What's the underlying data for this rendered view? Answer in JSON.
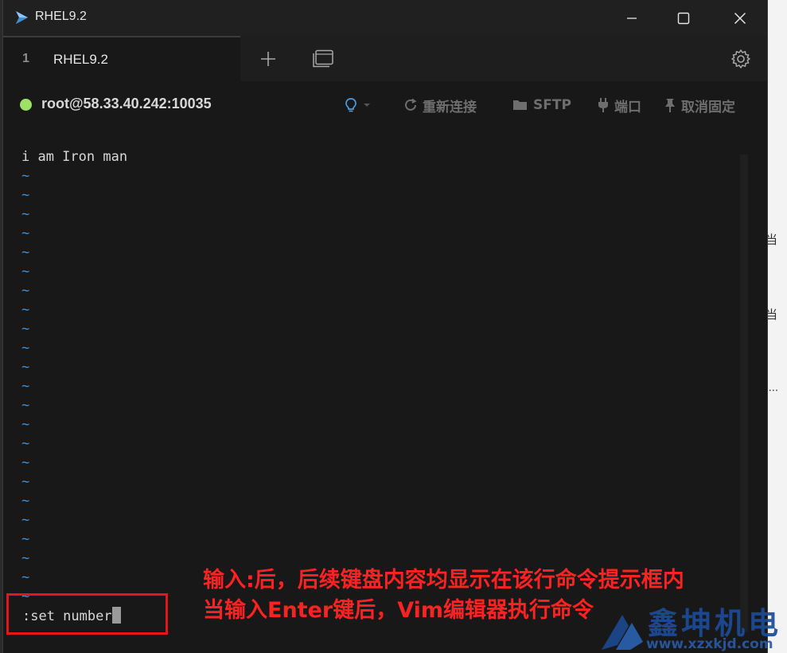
{
  "window": {
    "title": "RHEL9.2",
    "controls": {
      "minimize": "minimize-icon",
      "maximize": "maximize-icon",
      "close": "close-icon"
    }
  },
  "tabs": [
    {
      "index": "1",
      "label": "RHEL9.2"
    }
  ],
  "tabbar_icons": [
    "plus-icon",
    "windows-icon",
    "gear-icon"
  ],
  "status": {
    "connected_color": "#9ee265",
    "host": "root@58.33.40.242:10035",
    "items": [
      {
        "label": "重新连接",
        "icon": "refresh-icon"
      },
      {
        "label": "SFTP",
        "icon": "folder-icon"
      },
      {
        "label": "端口",
        "icon": "plug-icon"
      },
      {
        "label": "取消固定",
        "icon": "pin-icon"
      }
    ],
    "bulb_icon": "lightbulb-icon"
  },
  "terminal": {
    "first_line": "i am Iron man",
    "tilde": "~",
    "tilde_color": "#3d8fd1",
    "command_line": ":set number"
  },
  "annotation": {
    "line1": "输入:后，后续键盘内容均显示在该行命令提示框内",
    "line2": "当输入Enter键后，Vim编辑器执行命令",
    "color": "#ff2222"
  },
  "watermark": {
    "name": "鑫坤机电",
    "url": "www.xzxkjd.com"
  },
  "background": {
    "chars": [
      "当",
      "当",
      "i..."
    ]
  }
}
